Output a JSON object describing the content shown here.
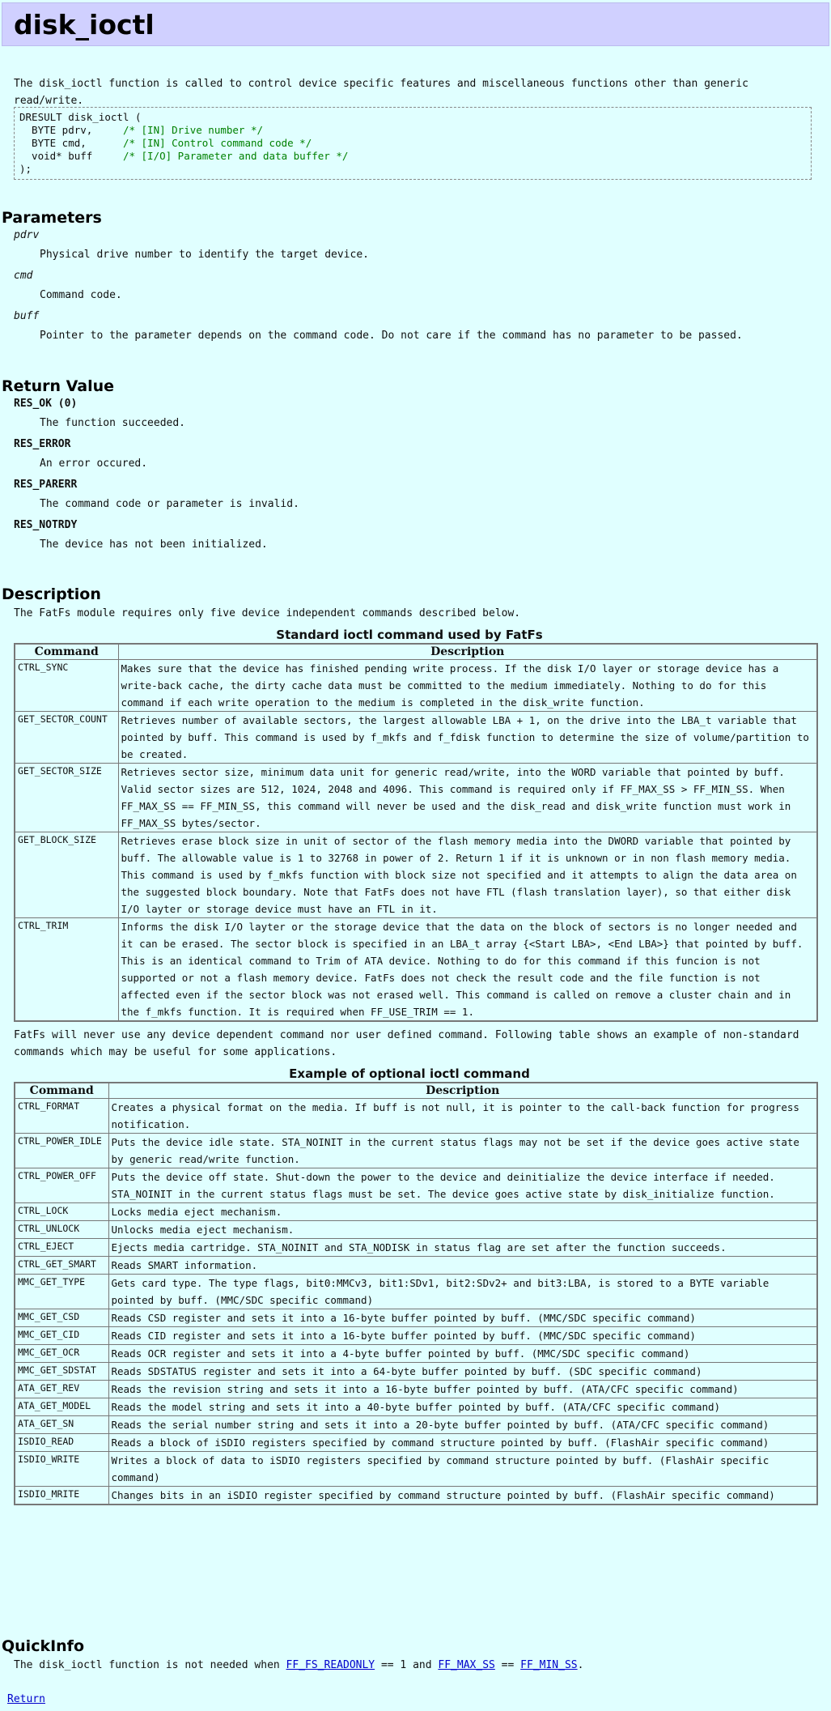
{
  "title": "disk_ioctl",
  "intro": "The disk_ioctl function is called to control device specific features and miscellaneous functions other than generic read/write.",
  "prototype": [
    {
      "code": "DRESULT disk_ioctl (",
      "comment": ""
    },
    {
      "code": "  BYTE pdrv,     ",
      "comment": "/* [IN] Drive number */"
    },
    {
      "code": "  BYTE cmd,      ",
      "comment": "/* [IN] Control command code */"
    },
    {
      "code": "  void* buff     ",
      "comment": "/* [I/O] Parameter and data buffer */"
    },
    {
      "code": ");",
      "comment": ""
    }
  ],
  "parameters": {
    "heading": "Parameters",
    "items": [
      {
        "name": "pdrv",
        "desc": "Physical drive number to identify the target device."
      },
      {
        "name": "cmd",
        "desc": "Command code."
      },
      {
        "name": "buff",
        "desc": "Pointer to the parameter depends on the command code. Do not care if the command has no parameter to be passed."
      }
    ]
  },
  "return_value": {
    "heading": "Return Value",
    "items": [
      {
        "name": "RES_OK (0)",
        "desc": "The function succeeded."
      },
      {
        "name": "RES_ERROR",
        "desc": "An error occured."
      },
      {
        "name": "RES_PARERR",
        "desc": "The command code or parameter is invalid."
      },
      {
        "name": "RES_NOTRDY",
        "desc": "The device has not been initialized."
      }
    ]
  },
  "description": {
    "heading": "Description",
    "intro": "The FatFs module requires only five device independent commands described below.",
    "standard_caption": "Standard ioctl command used by FatFs",
    "col_command": "Command",
    "col_description": "Description",
    "standard_rows": [
      {
        "cmd": "CTRL_SYNC",
        "desc": "Makes sure that the device has finished pending write process. If the disk I/O layer or storage device has a write-back cache, the dirty cache data must be committed to the medium immediately. Nothing to do for this command if each write operation to the medium is completed in the disk_write function."
      },
      {
        "cmd": "GET_SECTOR_COUNT",
        "desc": "Retrieves number of available sectors, the largest allowable LBA + 1, on the drive into the LBA_t variable that pointed by buff. This command is used by f_mkfs and f_fdisk function to determine the size of volume/partition to be created."
      },
      {
        "cmd": "GET_SECTOR_SIZE",
        "desc": "Retrieves sector size, minimum data unit for generic read/write, into the WORD variable that pointed by buff. Valid sector sizes are 512, 1024, 2048 and 4096. This command is required only if FF_MAX_SS > FF_MIN_SS. When FF_MAX_SS == FF_MIN_SS, this command will never be used and the disk_read and disk_write function must work in FF_MAX_SS bytes/sector."
      },
      {
        "cmd": "GET_BLOCK_SIZE",
        "desc": "Retrieves erase block size in unit of sector of the flash memory media into the DWORD variable that pointed by buff. The allowable value is 1 to 32768 in power of 2. Return 1 if it is unknown or in non flash memory media. This command is used by f_mkfs function with block size not specified and it attempts to align the data area on the suggested block boundary. Note that FatFs does not have FTL (flash translation layer), so that either disk I/O layter or storage device must have an FTL in it."
      },
      {
        "cmd": "CTRL_TRIM",
        "desc": "Informs the disk I/O layter or the storage device that the data on the block of sectors is no longer needed and it can be erased. The sector block is specified in an LBA_t array {<Start LBA>, <End LBA>} that pointed by buff. This is an identical command to Trim of ATA device. Nothing to do for this command if this funcion is not supported or not a flash memory device. FatFs does not check the result code and the file function is not affected even if the sector block was not erased well. This command is called on remove a cluster chain and in the f_mkfs function. It is required when FF_USE_TRIM == 1."
      }
    ],
    "middle_text": "FatFs will never use any device dependent command nor user defined command. Following table shows an example of non-standard commands which may be useful for some applications.",
    "optional_caption": "Example of optional ioctl command",
    "optional_rows": [
      {
        "cmd": "CTRL_FORMAT",
        "desc": "Creates a physical format on the media. If buff is not null, it is pointer to the call-back function for progress notification."
      },
      {
        "cmd": "CTRL_POWER_IDLE",
        "desc": "Puts the device idle state. STA_NOINIT in the current status flags may not be set if the device goes active state by generic read/write function."
      },
      {
        "cmd": "CTRL_POWER_OFF",
        "desc": "Puts the device off state. Shut-down the power to the device and deinitialize the device interface if needed. STA_NOINIT in the current status flags must be set. The device goes active state by disk_initialize function."
      },
      {
        "cmd": "CTRL_LOCK",
        "desc": "Locks media eject mechanism."
      },
      {
        "cmd": "CTRL_UNLOCK",
        "desc": "Unlocks media eject mechanism."
      },
      {
        "cmd": "CTRL_EJECT",
        "desc": "Ejects media cartridge. STA_NOINIT and STA_NODISK in status flag are set after the function succeeds."
      },
      {
        "cmd": "CTRL_GET_SMART",
        "desc": "Reads SMART information."
      },
      {
        "cmd": "MMC_GET_TYPE",
        "desc": "Gets card type. The type flags, bit0:MMCv3, bit1:SDv1, bit2:SDv2+ and bit3:LBA, is stored to a BYTE variable pointed by buff. (MMC/SDC specific command)"
      },
      {
        "cmd": "MMC_GET_CSD",
        "desc": "Reads CSD register and sets it into a 16-byte buffer pointed by buff. (MMC/SDC specific command)"
      },
      {
        "cmd": "MMC_GET_CID",
        "desc": "Reads CID register and sets it into a 16-byte buffer pointed by buff. (MMC/SDC specific command)"
      },
      {
        "cmd": "MMC_GET_OCR",
        "desc": "Reads OCR register and sets it into a 4-byte buffer pointed by buff. (MMC/SDC specific command)"
      },
      {
        "cmd": "MMC_GET_SDSTAT",
        "desc": "Reads SDSTATUS register and sets it into a 64-byte buffer pointed by buff. (SDC specific command)"
      },
      {
        "cmd": "ATA_GET_REV",
        "desc": "Reads the revision string and sets it into a 16-byte buffer pointed by buff. (ATA/CFC specific command)"
      },
      {
        "cmd": "ATA_GET_MODEL",
        "desc": "Reads the model string and sets it into a 40-byte buffer pointed by buff. (ATA/CFC specific command)"
      },
      {
        "cmd": "ATA_GET_SN",
        "desc": "Reads the serial number string and sets it into a 20-byte buffer pointed by buff. (ATA/CFC specific command)"
      },
      {
        "cmd": "ISDIO_READ",
        "desc": "Reads a block of iSDIO registers specified by command structure pointed by buff. (FlashAir specific command)"
      },
      {
        "cmd": "ISDIO_WRITE",
        "desc": "Writes a block of data to iSDIO registers specified by command structure pointed by buff. (FlashAir specific command)"
      },
      {
        "cmd": "ISDIO_MRITE",
        "desc": "Changes bits in an iSDIO register specified by command structure pointed by buff. (FlashAir specific command)"
      }
    ]
  },
  "quickinfo": {
    "heading": "QuickInfo",
    "text_before": "The disk_ioctl function is not needed when ",
    "link1": "FF_FS_READONLY",
    "text_mid1": " == 1 and ",
    "link2": "FF_MAX_SS",
    "text_mid2": " == ",
    "link3": "FF_MIN_SS",
    "text_after": "."
  },
  "return_link": "Return"
}
